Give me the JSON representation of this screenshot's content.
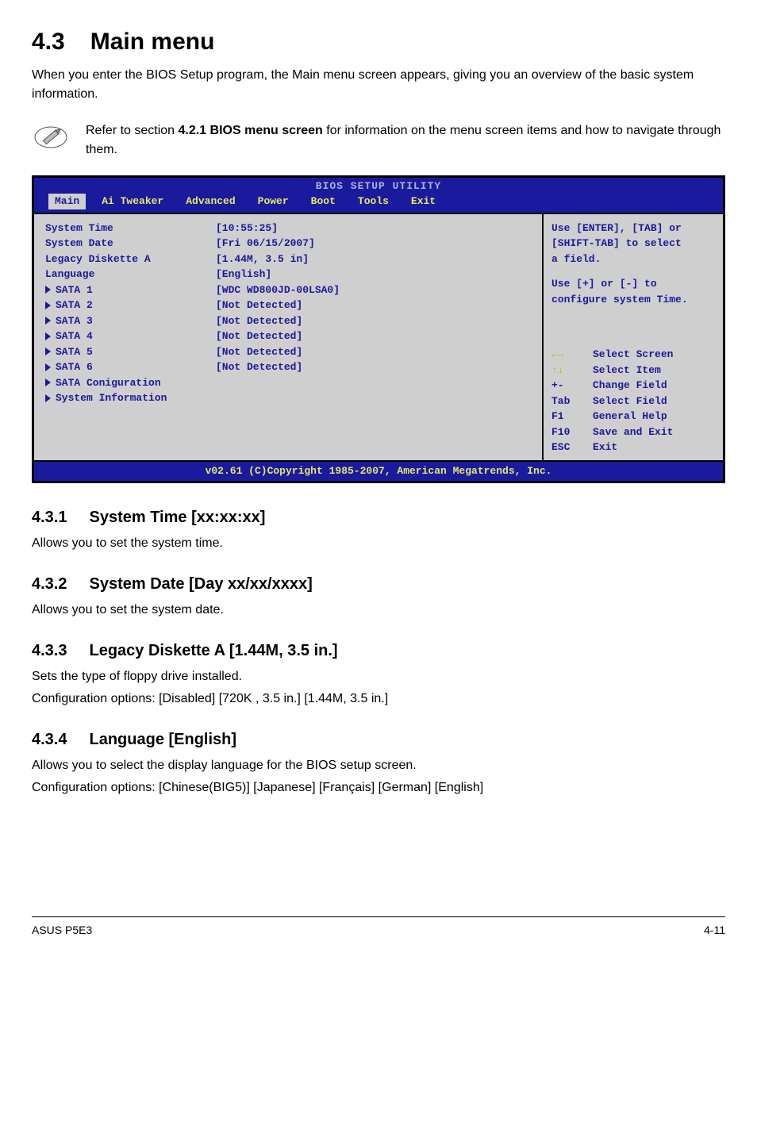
{
  "title": {
    "num": "4.3",
    "text": "Main menu"
  },
  "intro": "When you enter the BIOS Setup program, the Main menu screen appears, giving you an overview of the basic system information.",
  "note": {
    "pre": "Refer to section ",
    "bold": "4.2.1  BIOS menu screen",
    "post": " for information on the menu screen items and how to navigate through them."
  },
  "bios": {
    "header": "BIOS SETUP UTILITY",
    "tabs": [
      "Main",
      "Ai Tweaker",
      "Advanced",
      "Power",
      "Boot",
      "Tools",
      "Exit"
    ],
    "rows": [
      {
        "key": "System Time",
        "val": "[10:55:25]",
        "tri": false
      },
      {
        "key": "System Date",
        "val": "[Fri 06/15/2007]",
        "tri": false
      },
      {
        "key": "Legacy Diskette A",
        "val": "[1.44M, 3.5 in]",
        "tri": false
      },
      {
        "key": "Language",
        "val": "[English]",
        "tri": false
      },
      {
        "key": "",
        "val": "",
        "tri": false
      },
      {
        "key": "SATA 1",
        "val": "[WDC WD800JD-00LSA0]",
        "tri": true
      },
      {
        "key": "SATA 2",
        "val": "[Not Detected]",
        "tri": true
      },
      {
        "key": "SATA 3",
        "val": "[Not Detected]",
        "tri": true
      },
      {
        "key": "SATA 4",
        "val": "[Not Detected]",
        "tri": true
      },
      {
        "key": "SATA 5",
        "val": "[Not Detected]",
        "tri": true
      },
      {
        "key": "SATA 6",
        "val": "[Not Detected]",
        "tri": true
      },
      {
        "key": "",
        "val": "",
        "tri": false
      },
      {
        "key": "SATA Coniguration",
        "val": "",
        "tri": true
      },
      {
        "key": "System Information",
        "val": "",
        "tri": true
      }
    ],
    "help1": "Use [ENTER], [TAB] or",
    "help2": "[SHIFT-TAB] to select",
    "help3": "a field.",
    "help4": "Use [+] or [-] to",
    "help5": "configure system Time.",
    "keys": [
      {
        "k": "←→",
        "t": "Select Screen",
        "cls": "icon-lr"
      },
      {
        "k": "↑↓",
        "t": "Select Item",
        "cls": "icon-ud"
      },
      {
        "k": "+-",
        "t": "Change Field"
      },
      {
        "k": "Tab",
        "t": "Select Field"
      },
      {
        "k": "F1",
        "t": "General Help"
      },
      {
        "k": "F10",
        "t": "Save and Exit"
      },
      {
        "k": "ESC",
        "t": "Exit"
      }
    ],
    "footer": "v02.61 (C)Copyright 1985-2007, American Megatrends, Inc."
  },
  "sections": [
    {
      "num": "4.3.1",
      "title": "System Time [xx:xx:xx]",
      "paras": [
        "Allows you to set the system time."
      ]
    },
    {
      "num": "4.3.2",
      "title": "System Date [Day xx/xx/xxxx]",
      "paras": [
        "Allows you to set the system date."
      ]
    },
    {
      "num": "4.3.3",
      "title": "Legacy Diskette A [1.44M, 3.5 in.]",
      "paras": [
        "Sets the type of floppy drive installed.",
        "Configuration options: [Disabled] [720K , 3.5 in.] [1.44M, 3.5 in.]"
      ]
    },
    {
      "num": "4.3.4",
      "title": "Language [English]",
      "paras": [
        "Allows you to select the display language for the BIOS setup screen.",
        "Configuration options: [Chinese(BIG5)] [Japanese] [Français] [German] [English]"
      ]
    }
  ],
  "footer": {
    "left": "ASUS P5E3",
    "right": "4-11"
  }
}
